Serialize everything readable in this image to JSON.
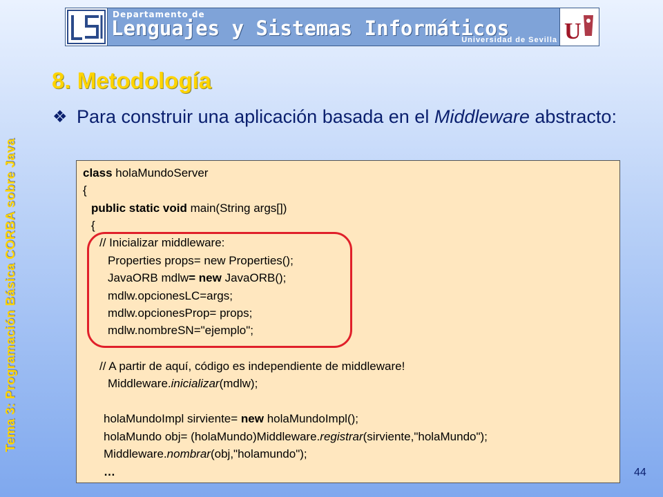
{
  "header": {
    "department": "Departamento de",
    "title": "Lenguajes y Sistemas Informáticos",
    "university": "Universidad de Sevilla"
  },
  "sidebar": {
    "topic": "Tema 3: Programación Básica CORBA sobre Java"
  },
  "slide": {
    "title": "8. Metodología",
    "bullet": {
      "before": "Para construir una aplicación basada en el ",
      "emphasis": "Middleware",
      "after": " abstracto:"
    }
  },
  "code": {
    "l1": {
      "kw": "class",
      "rest": " holaMundoServer"
    },
    "l2": "{",
    "l3": {
      "kw": "public static void",
      "rest": " main(String args[])"
    },
    "l4": "{",
    "l5": "// Inicializar middleware:",
    "l6": "Properties props= new Properties();",
    "l7": {
      "a": "JavaORB mdlw",
      "kw": "= new",
      "b": " JavaORB();"
    },
    "l8": "mdlw.opcionesLC=args;",
    "l9": "mdlw.opcionesProp= props;",
    "l10": "mdlw.nombreSN=\"ejemplo\";",
    "l11": "// A partir de aquí, código es independiente de middleware!",
    "l12": {
      "a": "Middleware.",
      "it": "inicializar",
      "b": "(mdlw);"
    },
    "l13": {
      "a": "holaMundoImpl sirviente= ",
      "kw": "new",
      "b": " holaMundoImpl();"
    },
    "l14": {
      "a": "holaMundo obj= (holaMundo)Middleware.",
      "it": "registrar",
      "b": "(sirviente,\"holaMundo\");"
    },
    "l15": {
      "a": "Middleware.",
      "it": "nombrar",
      "b": "(obj,\"holamundo\");"
    },
    "l16": "…"
  },
  "page_number": "44",
  "colors": {
    "accent_yellow": "#ffd400",
    "text_navy": "#0a1f6e",
    "code_bg": "#ffe7bf",
    "highlight_red": "#e0202a"
  }
}
